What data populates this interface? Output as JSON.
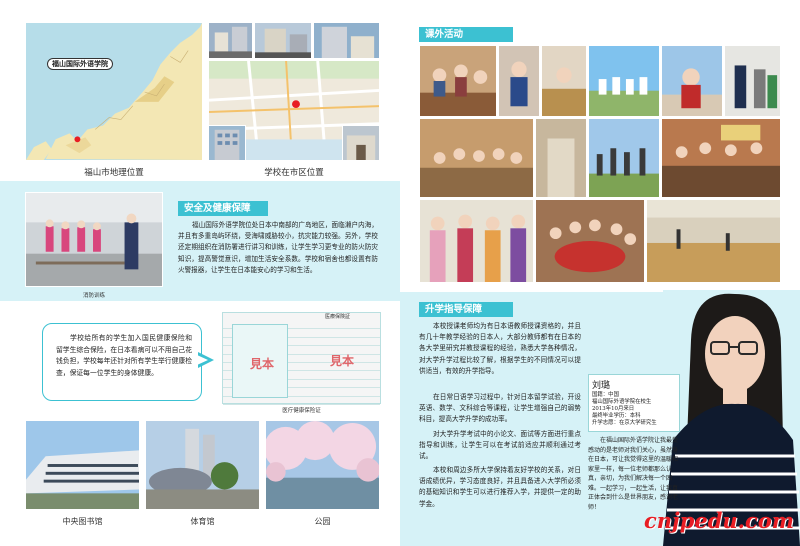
{
  "left": {
    "maps": {
      "map_label": "福山国际外语学院",
      "caption_city": "福山市地理位置",
      "caption_school": "学校在市区位置"
    },
    "safety": {
      "tag": "安全及健康保障",
      "text": "福山国际外语学院位处日本中南部的广岛地区，面临濑户内海，并且有多重岛屿环绕，受海啸威胁较小，抗灾能力较强。另外，学校还定期组织在消防署进行讲习和训练，让学生学习更专业的防火防灾知识，提高警觉意识，增加生活安全系数。学校和宿舍也都设置有防火警报器，让学生在日本能安心的学习和生活。",
      "photo_caption": "消防训练"
    },
    "health": {
      "text": "学校给所有的学生加入国民健康保险和留学生综合保险，在日本看病可以不用自己花钱负担，学校每年还针对所有学生举行健康检查，保证每一位学生的身体健康。",
      "form_title": "医療保険証",
      "stamp1": "見本",
      "stamp2": "見本",
      "form_caption": "医疗健康保险证"
    },
    "facilities": {
      "caption1": "中央图书馆",
      "caption2": "体育馆",
      "caption3": "公园"
    }
  },
  "right": {
    "activities": {
      "tag": "课外活动"
    },
    "guidance": {
      "tag": "升学指导保障",
      "p1": "本校授课老师均为有日本语教师授课资格的，并且有几十年教学经验的日本人，大部分教师都有在日本的各大学里研究并教授课程的经验，熟悉大学各种情况，对大学升学过程比较了解，根据学生的不同情况可以提供适当，有效的升学指导。",
      "p2": "在日常日语学习过程中，针对日本留学试验，开设英语、数学、文科综合等课程，让学生增强自己的弱势科目，提高大学升学的成功率。",
      "p3": "对大学升学考试中的小论文、面试等方面进行重点指导和训练，让学生可以在考试前适应并顺利通过考试。",
      "p4": "本校和周边多所大学保持着友好学校的关系，对日语成绩优异，学习态度良好，并且具备进入大学所必须的基础知识和学生可以进行推荐入学，并提供一定的助学金。"
    },
    "profile": {
      "name": "刘璐",
      "meta1": "国籍：中国",
      "meta2": "福山国际外语学院在校生",
      "meta3": "2013年10月来日",
      "meta4": "最终毕业学历：本科",
      "meta5": "升学志愿：在京大学研究生",
      "text": "在福山国际外语学院让我最受感动的是老师对我们关心，虽然身在日本，可让我觉得这里的温暖和家里一样，每一位老师都那么认真，亲切，为我们解决每一个困难。一起学习，一起生活，让我真正体会到什么是世界朋友，感谢老师！"
    },
    "watermark": "cnjpedu.com"
  },
  "colors": {
    "accent": "#3cc1d2",
    "band": "#d6f2f7",
    "watermark": "#e81e24"
  }
}
